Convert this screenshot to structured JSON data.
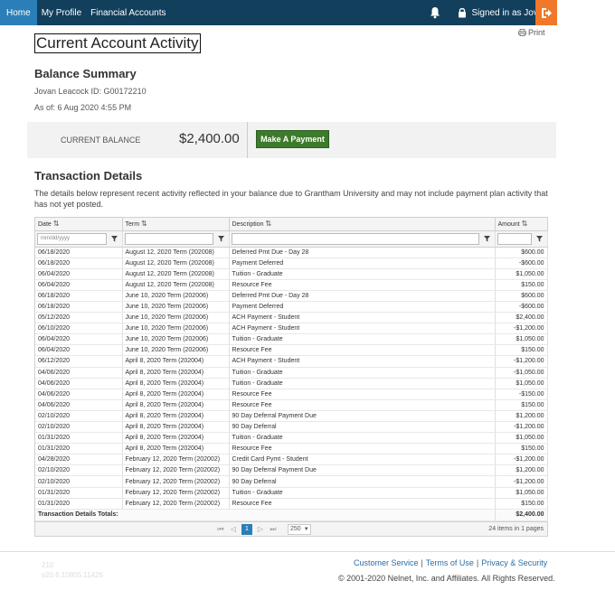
{
  "nav": {
    "items": [
      "Home",
      "My Profile",
      "Financial Accounts"
    ],
    "signed_in": "Signed in as Jovan"
  },
  "page": {
    "title": "Current Account Activity",
    "print": "Print"
  },
  "balance": {
    "heading": "Balance Summary",
    "name_id": "Jovan Leacock  ID: G00172210",
    "as_of": "As of: 6 Aug 2020 4:55 PM",
    "current_label": "CURRENT BALANCE",
    "amount": "$2,400.00",
    "pay_button": "Make A Payment"
  },
  "transactions": {
    "heading": "Transaction Details",
    "description": "The details below represent recent activity reflected in your balance due to Grantham University and may not include payment plan activity that has not yet posted.",
    "columns": [
      "Date",
      "Term",
      "Description",
      "Amount"
    ],
    "date_placeholder": "mm/dd/yyyy",
    "rows": [
      [
        "06/18/2020",
        "August 12, 2020 Term (202008)",
        "Deferred Pmt Due - Day 28",
        "$600.00"
      ],
      [
        "06/18/2020",
        "August 12, 2020 Term (202008)",
        "Payment Deferred",
        "-$600.00"
      ],
      [
        "06/04/2020",
        "August 12, 2020 Term (202008)",
        "Tuition - Graduate",
        "$1,050.00"
      ],
      [
        "06/04/2020",
        "August 12, 2020 Term (202008)",
        "Resource Fee",
        "$150.00"
      ],
      [
        "06/18/2020",
        "June 10, 2020 Term (202006)",
        "Deferred Pmt Due - Day 28",
        "$600.00"
      ],
      [
        "06/18/2020",
        "June 10, 2020 Term (202006)",
        "Payment Deferred",
        "-$600.00"
      ],
      [
        "05/12/2020",
        "June 10, 2020 Term (202006)",
        "ACH Payment - Student",
        "$2,400.00"
      ],
      [
        "06/10/2020",
        "June 10, 2020 Term (202006)",
        "ACH Payment - Student",
        "-$1,200.00"
      ],
      [
        "06/04/2020",
        "June 10, 2020 Term (202006)",
        "Tuition - Graduate",
        "$1,050.00"
      ],
      [
        "06/04/2020",
        "June 10, 2020 Term (202006)",
        "Resource Fee",
        "$150.00"
      ],
      [
        "06/12/2020",
        "April 8, 2020 Term (202004)",
        "ACH Payment - Student",
        "-$1,200.00"
      ],
      [
        "04/06/2020",
        "April 8, 2020 Term (202004)",
        "Tuition - Graduate",
        "-$1,050.00"
      ],
      [
        "04/06/2020",
        "April 8, 2020 Term (202004)",
        "Tuition - Graduate",
        "$1,050.00"
      ],
      [
        "04/06/2020",
        "April 8, 2020 Term (202004)",
        "Resource Fee",
        "-$150.00"
      ],
      [
        "04/06/2020",
        "April 8, 2020 Term (202004)",
        "Resource Fee",
        "$150.00"
      ],
      [
        "02/10/2020",
        "April 8, 2020 Term (202004)",
        "90 Day Deferral Payment Due",
        "$1,200.00"
      ],
      [
        "02/10/2020",
        "April 8, 2020 Term (202004)",
        "90 Day Deferral",
        "-$1,200.00"
      ],
      [
        "01/31/2020",
        "April 8, 2020 Term (202004)",
        "Tuition - Graduate",
        "$1,050.00"
      ],
      [
        "01/31/2020",
        "April 8, 2020 Term (202004)",
        "Resource Fee",
        "$150.00"
      ],
      [
        "04/28/2020",
        "February 12, 2020 Term (202002)",
        "Credit Card Pymt - Student",
        "-$1,200.00"
      ],
      [
        "02/10/2020",
        "February 12, 2020 Term (202002)",
        "90 Day Deferral Payment Due",
        "$1,200.00"
      ],
      [
        "02/10/2020",
        "February 12, 2020 Term (202002)",
        "90 Day Deferral",
        "-$1,200.00"
      ],
      [
        "01/31/2020",
        "February 12, 2020 Term (202002)",
        "Tuition - Graduate",
        "$1,050.00"
      ],
      [
        "01/31/2020",
        "February 12, 2020 Term (202002)",
        "Resource Fee",
        "$150.00"
      ]
    ],
    "totals_label": "Transaction Details Totals:",
    "totals_amount": "$2,400.00",
    "pager": {
      "current_page": "1",
      "page_size": "250",
      "count_text": "24 items in 1 pages"
    }
  },
  "footer": {
    "version_code": "210",
    "version": "v20.6.10805.11426",
    "links": [
      "Customer Service",
      "Terms of Use",
      "Privacy & Security"
    ],
    "copyright": "© 2001-2020 Nelnet, Inc. and Affiliates. All Rights Reserved."
  }
}
